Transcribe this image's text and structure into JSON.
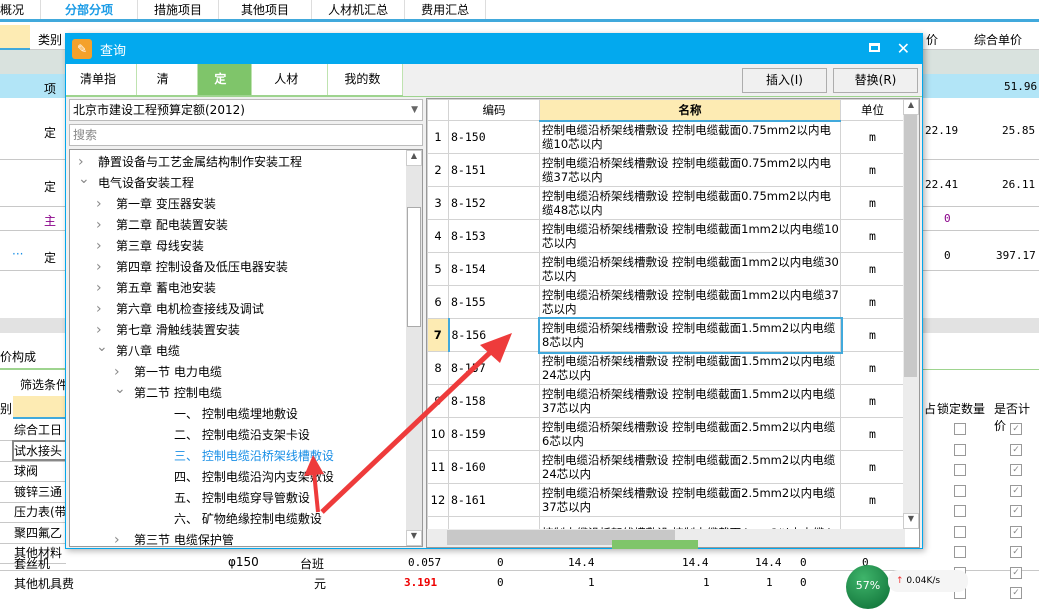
{
  "top_tabs": [
    "概况",
    "分部分项",
    "措施项目",
    "其他项目",
    "人材机汇总",
    "费用汇总"
  ],
  "top_active": "分部分项",
  "bg": {
    "col_header_type": "类别",
    "col_header_price": "价",
    "col_header_unit_price": "综合单价",
    "rows": [
      {
        "type": "项",
        "price": "",
        "unit_price": "51.96"
      },
      {
        "type": "定",
        "price": "22.19",
        "unit_price": "25.85"
      },
      {
        "type": "定",
        "price": "22.41",
        "unit_price": "26.11"
      },
      {
        "type": "主",
        "price": "0",
        "unit_price": ""
      },
      {
        "type": "定",
        "price": "0",
        "unit_price": "397.17",
        "ellipsis": "···"
      }
    ],
    "lower_tab": "价构成",
    "filter_label": "筛选条件",
    "lower_header_left": "别",
    "lower_header_lock": "锁定数量",
    "lower_header_priced": "是否计价",
    "lower_header_partial": "占",
    "materials": [
      "综合工日",
      "试水接头",
      "球阀",
      "镀锌三通",
      "压力表(带",
      "聚四氟乙",
      "其他材料"
    ],
    "bottom_rows": [
      {
        "name": "套丝机",
        "spec": "φ150",
        "unit": "台班",
        "qty": "0.057",
        "a": "0",
        "b": "14.4",
        "c": "14.4",
        "d": "14.4",
        "e": "0",
        "f": "0"
      },
      {
        "name": "其他机具费",
        "spec": "",
        "unit": "元",
        "qty": "3.191",
        "a": "0",
        "b": "1",
        "c": "1",
        "d": "1",
        "e": "0",
        "f": ""
      }
    ],
    "net_percent": "57%",
    "net_speed": "0.04K/s"
  },
  "dialog": {
    "title": "查询",
    "tabs": [
      "清单指引",
      "清单",
      "定额",
      "人材机",
      "我的数据"
    ],
    "active_tab": "定额",
    "insert_label": "插入(I)",
    "replace_label": "替换(R)",
    "library": "北京市建设工程预算定额(2012)",
    "search_placeholder": "搜索",
    "tree": [
      {
        "label": "静置设备与工艺金属结构制作安装工程",
        "level": 0,
        "state": "collapsed"
      },
      {
        "label": "电气设备安装工程",
        "level": 0,
        "state": "expanded"
      },
      {
        "label": "第一章  变压器安装",
        "level": 1,
        "state": "collapsed"
      },
      {
        "label": "第二章  配电装置安装",
        "level": 1,
        "state": "collapsed"
      },
      {
        "label": "第三章  母线安装",
        "level": 1,
        "state": "collapsed"
      },
      {
        "label": "第四章  控制设备及低压电器安装",
        "level": 1,
        "state": "collapsed"
      },
      {
        "label": "第五章  蓄电池安装",
        "level": 1,
        "state": "collapsed"
      },
      {
        "label": "第六章  电机检查接线及调试",
        "level": 1,
        "state": "collapsed"
      },
      {
        "label": "第七章  滑触线装置安装",
        "level": 1,
        "state": "collapsed"
      },
      {
        "label": "第八章  电缆",
        "level": 1,
        "state": "expanded"
      },
      {
        "label": "第一节  电力电缆",
        "level": 2,
        "state": "collapsed"
      },
      {
        "label": "第二节  控制电缆",
        "level": 2,
        "state": "expanded"
      },
      {
        "label": "一、  控制电缆埋地敷设",
        "level": 3,
        "state": "leaf"
      },
      {
        "label": "二、  控制电缆沿支架卡设",
        "level": 3,
        "state": "leaf"
      },
      {
        "label": "三、  控制电缆沿桥架线槽敷设",
        "level": 3,
        "state": "selected"
      },
      {
        "label": "四、  控制电缆沿沟内支架敷设",
        "level": 3,
        "state": "leaf"
      },
      {
        "label": "五、  控制电缆穿导管敷设",
        "level": 3,
        "state": "leaf"
      },
      {
        "label": "六、  矿物绝缘控制电缆敷设",
        "level": 3,
        "state": "leaf"
      },
      {
        "label": "第三节  电缆保护管",
        "level": 2,
        "state": "collapsed"
      }
    ],
    "grid_headers": {
      "code": "编码",
      "name": "名称",
      "unit": "单位"
    },
    "rows": [
      {
        "n": "1",
        "code": "8-150",
        "name": "控制电缆沿桥架线槽敷设 控制电缆截面0.75mm2以内电缆10芯以内",
        "unit": "m"
      },
      {
        "n": "2",
        "code": "8-151",
        "name": "控制电缆沿桥架线槽敷设 控制电缆截面0.75mm2以内电缆37芯以内",
        "unit": "m"
      },
      {
        "n": "3",
        "code": "8-152",
        "name": "控制电缆沿桥架线槽敷设 控制电缆截面0.75mm2以内电缆48芯以内",
        "unit": "m"
      },
      {
        "n": "4",
        "code": "8-153",
        "name": "控制电缆沿桥架线槽敷设 控制电缆截面1mm2以内电缆10芯以内",
        "unit": "m"
      },
      {
        "n": "5",
        "code": "8-154",
        "name": "控制电缆沿桥架线槽敷设 控制电缆截面1mm2以内电缆30芯以内",
        "unit": "m"
      },
      {
        "n": "6",
        "code": "8-155",
        "name": "控制电缆沿桥架线槽敷设 控制电缆截面1mm2以内电缆37芯以内",
        "unit": "m"
      },
      {
        "n": "7",
        "code": "8-156",
        "name": "控制电缆沿桥架线槽敷设 控制电缆截面1.5mm2以内电缆8芯以内",
        "unit": "m",
        "selected": true
      },
      {
        "n": "8",
        "code": "8-157",
        "name": "控制电缆沿桥架线槽敷设 控制电缆截面1.5mm2以内电缆24芯以内",
        "unit": "m"
      },
      {
        "n": "9",
        "code": "8-158",
        "name": "控制电缆沿桥架线槽敷设 控制电缆截面1.5mm2以内电缆37芯以内",
        "unit": "m"
      },
      {
        "n": "10",
        "code": "8-159",
        "name": "控制电缆沿桥架线槽敷设 控制电缆截面2.5mm2以内电缆6芯以内",
        "unit": "m"
      },
      {
        "n": "11",
        "code": "8-160",
        "name": "控制电缆沿桥架线槽敷设 控制电缆截面2.5mm2以内电缆24芯以内",
        "unit": "m"
      },
      {
        "n": "12",
        "code": "8-161",
        "name": "控制电缆沿桥架线槽敷设 控制电缆截面2.5mm2以内电缆37芯以内",
        "unit": "m"
      },
      {
        "n": "",
        "code": "",
        "name": "控制电缆沿桥架线槽敷设 控制电缆截面4mm2以内电缆4",
        "unit": ""
      }
    ]
  },
  "colors": {
    "accent": "#03a9ee",
    "tab_active": "#7fc56a",
    "header_highlight": "#fdebb3",
    "selected_text": "#1a8fe6",
    "arrow": "#ee3b3b"
  }
}
